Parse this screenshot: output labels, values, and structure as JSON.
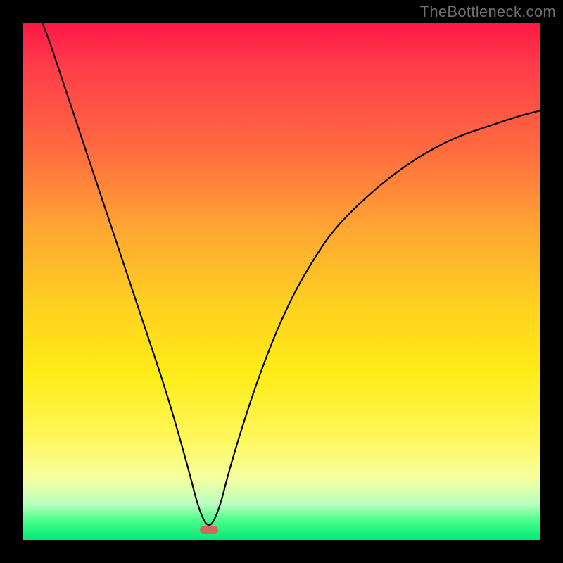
{
  "watermark": "TheBottleneck.com",
  "colors": {
    "frame": "#000000",
    "curve_stroke": "#000000",
    "marker": "#cc6a5f",
    "gradient_stops": [
      "#ff1745",
      "#ff3b4a",
      "#ff6d3f",
      "#ffa733",
      "#ffd21f",
      "#ffec18",
      "#fff75a",
      "#f6ffa0",
      "#b9ffc0",
      "#4cff8a",
      "#00e878"
    ]
  },
  "chart_data": {
    "type": "line",
    "title": "",
    "xlabel": "",
    "ylabel": "",
    "xlim": [
      0,
      100
    ],
    "ylim": [
      0,
      100
    ],
    "x_minimum": 36,
    "series": [
      {
        "name": "bottleneck-curve",
        "x": [
          0,
          4,
          8,
          12,
          16,
          20,
          24,
          28,
          32,
          34,
          36,
          38,
          40,
          44,
          48,
          52,
          56,
          60,
          66,
          72,
          78,
          84,
          90,
          96,
          100
        ],
        "values": [
          108,
          100,
          88,
          76,
          64,
          52,
          40,
          28,
          14,
          6,
          2,
          6,
          14,
          27,
          38,
          47,
          54,
          60,
          66,
          71,
          75,
          78,
          80,
          82,
          83
        ]
      }
    ],
    "marker": {
      "x": 36,
      "y": 2,
      "label": ""
    }
  }
}
